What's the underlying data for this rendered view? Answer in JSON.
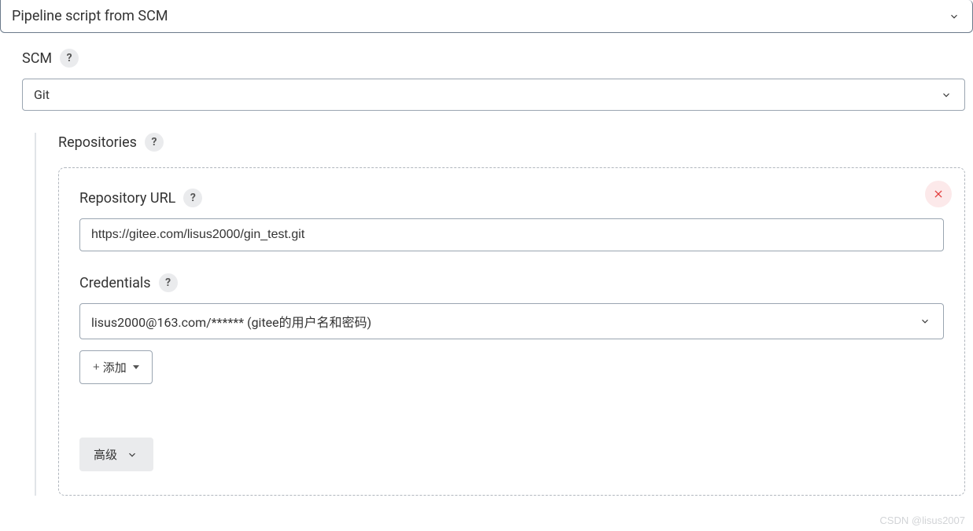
{
  "pipeline_definition": {
    "selected": "Pipeline script from SCM"
  },
  "scm": {
    "label": "SCM",
    "selected": "Git"
  },
  "repositories": {
    "label": "Repositories",
    "items": [
      {
        "url_label": "Repository URL",
        "url_value": "https://gitee.com/lisus2000/gin_test.git",
        "credentials_label": "Credentials",
        "credentials_selected": "lisus2000@163.com/****** (gitee的用户名和密码)",
        "add_button_label": "添加",
        "advanced_button_label": "高级"
      }
    ]
  },
  "watermark": "CSDN @lisus2007"
}
